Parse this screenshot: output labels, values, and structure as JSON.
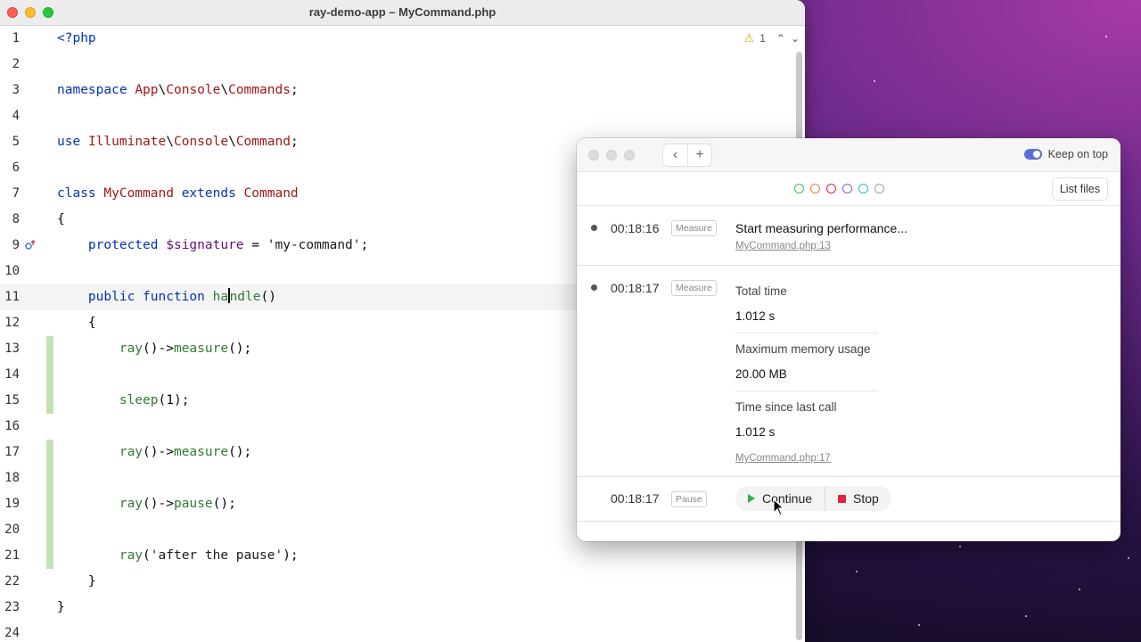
{
  "editor": {
    "title": "ray-demo-app – MyCommand.php",
    "warning_count": "1",
    "lines": [
      {
        "n": "1",
        "html": "<span class='kw'>&lt;?php</span>"
      },
      {
        "n": "2",
        "html": ""
      },
      {
        "n": "3",
        "html": "<span class='kw'>namespace</span> <span class='cls'>App</span>\\<span class='cls'>Console</span>\\<span class='cls'>Commands</span>;"
      },
      {
        "n": "4",
        "html": ""
      },
      {
        "n": "5",
        "html": "<span class='kw'>use</span> <span class='cls'>Illuminate</span>\\<span class='cls'>Console</span>\\<span class='cls'>Command</span>;"
      },
      {
        "n": "6",
        "html": ""
      },
      {
        "n": "7",
        "html": "<span class='kw'>class</span> <span class='cls'>MyCommand</span> <span class='kw'>extends</span> <span class='cls'>Command</span>"
      },
      {
        "n": "8",
        "html": "{"
      },
      {
        "n": "9",
        "html": "    <span class='kw'>protected</span> <span class='var'>$signature</span> = <span class='str'>'my-command'</span>;"
      },
      {
        "n": "10",
        "html": ""
      },
      {
        "n": "11",
        "html": "    <span class='kw'>public function</span> <span class='fn'>ha<span class='cursor'></span>ndle</span>()"
      },
      {
        "n": "12",
        "html": "    {"
      },
      {
        "n": "13",
        "html": "        <span class='fn'>ray</span>()-&gt;<span class='fn'>measure</span>();"
      },
      {
        "n": "14",
        "html": ""
      },
      {
        "n": "15",
        "html": "        <span class='fn'>sleep</span>(1);"
      },
      {
        "n": "16",
        "html": ""
      },
      {
        "n": "17",
        "html": "        <span class='fn'>ray</span>()-&gt;<span class='fn'>measure</span>();"
      },
      {
        "n": "18",
        "html": ""
      },
      {
        "n": "19",
        "html": "        <span class='fn'>ray</span>()-&gt;<span class='fn'>pause</span>();"
      },
      {
        "n": "20",
        "html": ""
      },
      {
        "n": "21",
        "html": "        <span class='fn'>ray</span>(<span class='str'>'after the pause'</span>);"
      },
      {
        "n": "22",
        "html": "    }"
      },
      {
        "n": "23",
        "html": "}"
      },
      {
        "n": "24",
        "html": ""
      }
    ]
  },
  "ray": {
    "keep_on_top": "Keep on top",
    "list_files": "List files",
    "filter_colors": [
      "#3fb950",
      "#e8843a",
      "#e0233b",
      "#8a5fd6",
      "#2eb6c9",
      "#a0a0a0"
    ],
    "entry1": {
      "time": "00:18:16",
      "badge": "Measure",
      "message": "Start measuring performance...",
      "file": "MyCommand.php:13"
    },
    "entry2": {
      "time": "00:18:17",
      "badge": "Measure",
      "total_time_label": "Total time",
      "total_time_value": "1.012 s",
      "memory_label": "Maximum memory usage",
      "memory_value": "20.00 MB",
      "since_label": "Time since last call",
      "since_value": "1.012 s",
      "file": "MyCommand.php:17"
    },
    "entry3": {
      "time": "00:18:17",
      "badge": "Pause",
      "continue_label": "Continue",
      "stop_label": "Stop"
    }
  }
}
